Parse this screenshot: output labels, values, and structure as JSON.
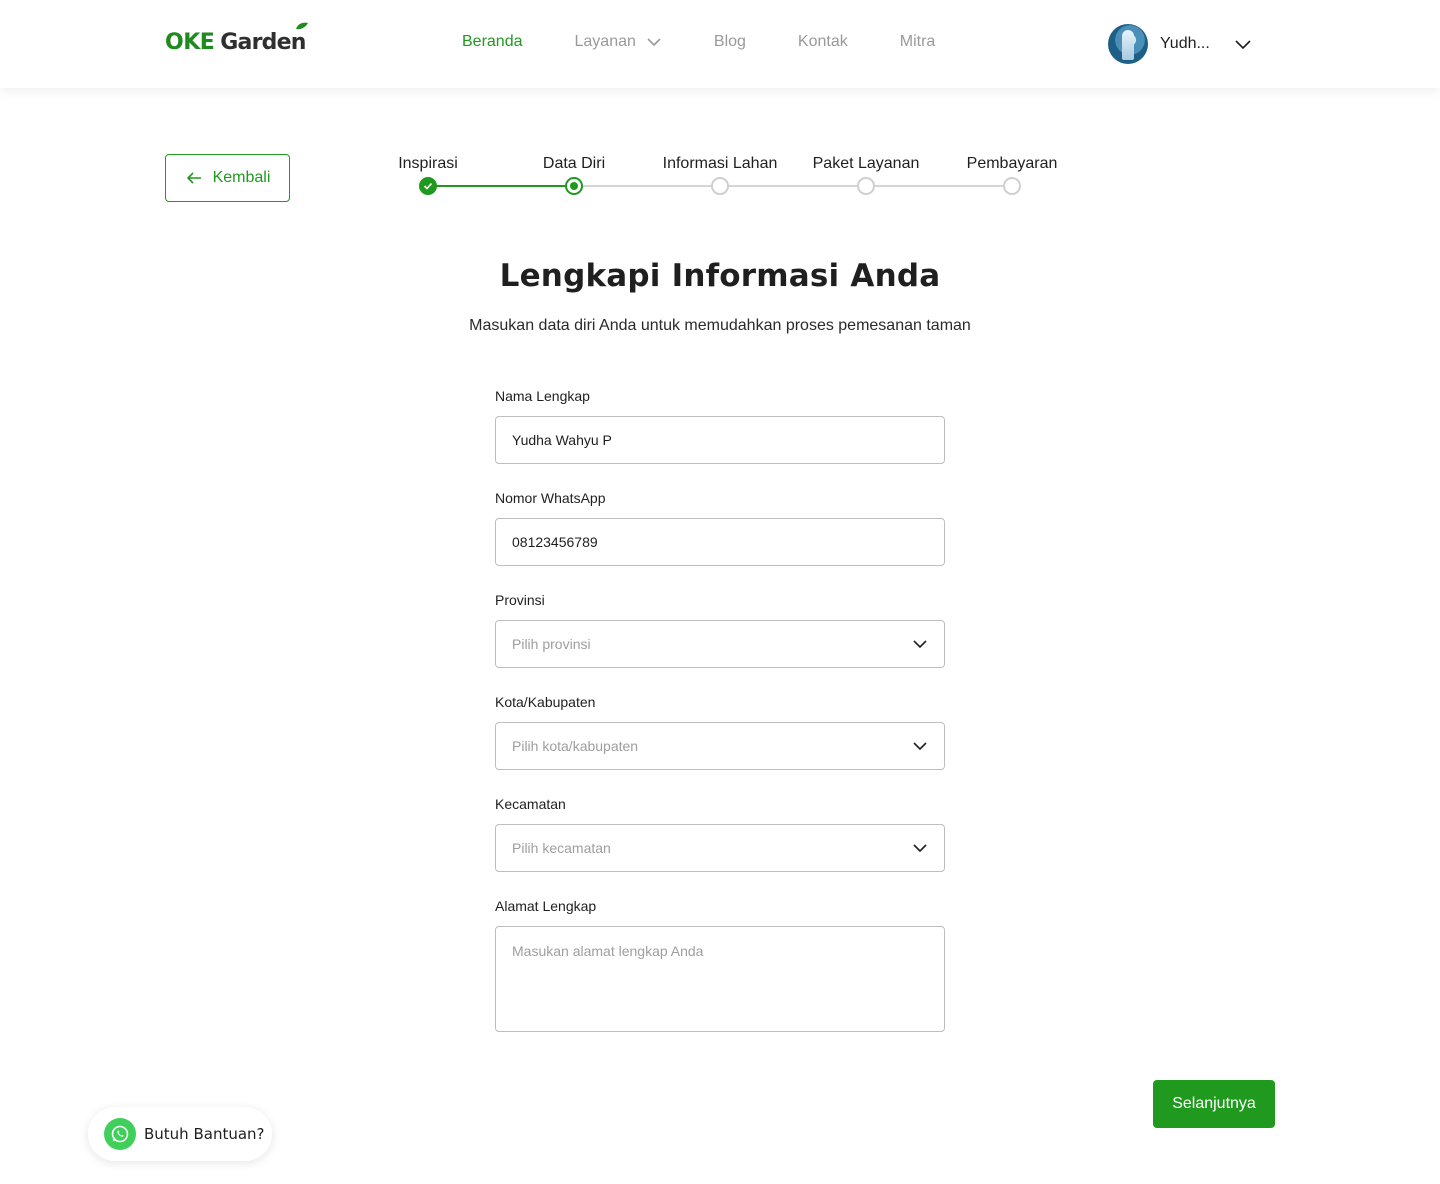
{
  "brand": {
    "name_part1": "OKE",
    "name_part2": "Garden",
    "primary_color": "#1f9a1f"
  },
  "nav": {
    "items": [
      {
        "label": "Beranda",
        "active": true
      },
      {
        "label": "Layanan",
        "has_dropdown": true
      },
      {
        "label": "Blog"
      },
      {
        "label": "Kontak"
      },
      {
        "label": "Mitra"
      }
    ]
  },
  "user": {
    "name": "Yudh...",
    "avatar_icon": "user-avatar"
  },
  "back_button": {
    "label": "Kembali",
    "icon": "arrow-left-icon"
  },
  "stepper": {
    "steps": [
      {
        "label": "Inspirasi",
        "state": "done"
      },
      {
        "label": "Data Diri",
        "state": "current"
      },
      {
        "label": "Informasi Lahan",
        "state": "pending"
      },
      {
        "label": "Paket Layanan",
        "state": "pending"
      },
      {
        "label": "Pembayaran",
        "state": "pending"
      }
    ]
  },
  "page": {
    "title": "Lengkapi Informasi Anda",
    "subtitle": "Masukan data diri Anda untuk memudahkan proses pemesanan taman"
  },
  "form": {
    "full_name": {
      "label": "Nama Lengkap",
      "value": "Yudha Wahyu P"
    },
    "whatsapp": {
      "label": "Nomor WhatsApp",
      "value": "08123456789"
    },
    "province": {
      "label": "Provinsi",
      "placeholder": "Pilih provinsi"
    },
    "city": {
      "label": "Kota/Kabupaten",
      "placeholder": "Pilih kota/kabupaten"
    },
    "district": {
      "label": "Kecamatan",
      "placeholder": "Pilih kecamatan"
    },
    "address": {
      "label": "Alamat Lengkap",
      "placeholder": "Masukan alamat lengkap Anda"
    }
  },
  "next_button": {
    "label": "Selanjutnya"
  },
  "help": {
    "label": "Butuh Bantuan?",
    "icon": "whatsapp-icon"
  }
}
